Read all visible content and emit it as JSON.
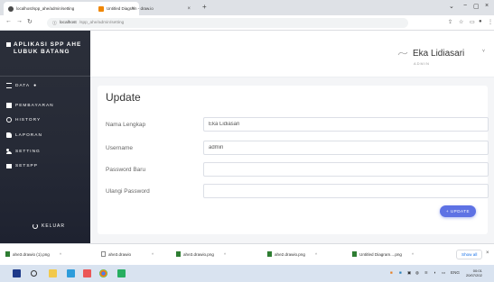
{
  "browser": {
    "tabs": [
      {
        "label": "localhost/spp_ahe/admin/setting"
      },
      {
        "label": "Untitled Diagram - draw.io"
      }
    ],
    "new_tab": "+",
    "address": {
      "host": "localhost",
      "path": "/spp_ahe/admin/setting"
    }
  },
  "sidebar": {
    "brand": "APLIKASI SPP AHE LUBUK BATANG",
    "menu": [
      {
        "label": "DATA"
      },
      {
        "label": "PEMBAYARAN"
      },
      {
        "label": "HISTORY"
      },
      {
        "label": "LAPORAN"
      },
      {
        "label": "SETTING"
      },
      {
        "label": "SETSPP"
      }
    ],
    "logout": "KELUAR"
  },
  "topnav": {
    "user_name": "Eka Lidiasari",
    "user_role": "ADMIN"
  },
  "form": {
    "title": "Update",
    "fields": [
      {
        "label": "Nama Lengkap",
        "value": "Eka Lidiasari"
      },
      {
        "label": "Username",
        "value": "admin"
      },
      {
        "label": "Password Baru",
        "value": ""
      },
      {
        "label": "Ulangi Password",
        "value": ""
      }
    ],
    "submit": "+ UPDATE"
  },
  "downloads": [
    {
      "name": "ahe3.drawio (1).png"
    },
    {
      "name": "ahe3.drawio"
    },
    {
      "name": "ahe3.drawio.png"
    },
    {
      "name": "ahe2.drawio.png"
    },
    {
      "name": "Untitled Diagram....png"
    }
  ],
  "downloads_show_all": "Show all",
  "taskbar": {
    "time": "00:01",
    "date": "20/07/202"
  },
  "colors": {
    "sidebar_bg": "#2b2f3a",
    "accent": "#5e72e4",
    "content_bg": "#f4f5f7"
  }
}
